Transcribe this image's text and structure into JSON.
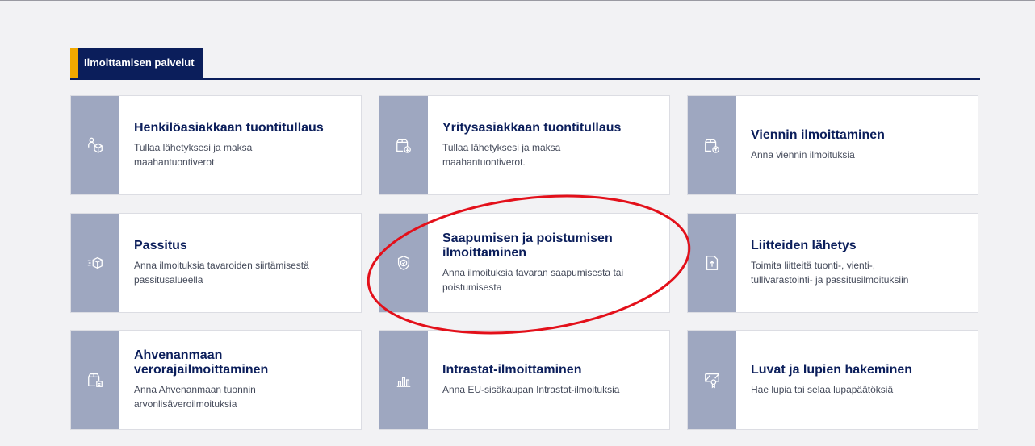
{
  "section": {
    "title": "Ilmoittamisen palvelut"
  },
  "cards": [
    {
      "title": "Henkilöasiakkaan tuontitullaus",
      "desc_lines": [
        "Tullaa lähetyksesi ja maksa",
        "maahantuontiverot"
      ],
      "icon": "person-package-icon"
    },
    {
      "title": "Yritysasiakkaan tuontitullaus",
      "desc_lines": [
        "Tullaa lähetyksesi ja maksa",
        "maahantuontiverot."
      ],
      "icon": "package-import-icon"
    },
    {
      "title": "Viennin ilmoittaminen",
      "desc_lines": [
        "Anna viennin ilmoituksia",
        ""
      ],
      "icon": "package-export-icon"
    },
    {
      "title": "Passitus",
      "desc_lines": [
        "Anna ilmoituksia tavaroiden siirtämisestä",
        "passitusalueella"
      ],
      "icon": "moving-box-icon"
    },
    {
      "title_lines": [
        "Saapumisen ja poistumisen",
        "ilmoittaminen"
      ],
      "desc_lines": [
        "Anna ilmoituksia tavaran saapumisesta tai",
        "poistumisesta"
      ],
      "icon": "shield-check-icon"
    },
    {
      "title": "Liitteiden lähetys",
      "desc_lines": [
        "Toimita liitteitä tuonti-, vienti-,",
        "tullivarastointi- ja passitusilmoituksiin"
      ],
      "icon": "document-upload-icon"
    },
    {
      "title_lines": [
        "Ahvenanmaan",
        "verorajailmoittaminen"
      ],
      "desc_lines": [
        "Anna Ahvenanmaan tuonnin",
        "arvonlisäveroilmoituksia"
      ],
      "icon": "box-document-icon"
    },
    {
      "title": "Intrastat-ilmoittaminen",
      "desc_lines": [
        "Anna EU-sisäkaupan Intrastat-ilmoituksia",
        ""
      ],
      "icon": "bar-chart-icon"
    },
    {
      "title": "Luvat ja lupien hakeminen",
      "desc_lines": [
        "Hae lupia tai selaa lupapäätöksiä",
        ""
      ],
      "icon": "certificate-icon"
    }
  ],
  "colors": {
    "navy": "#0b1e5b",
    "accent": "#f2a900",
    "icon_strip": "#9ea7c0",
    "highlight": "#e3101a"
  }
}
